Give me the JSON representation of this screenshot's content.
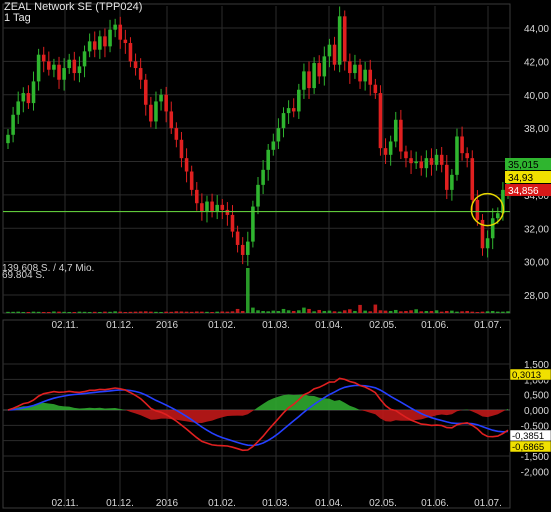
{
  "header": {
    "title": "ZEAL Network SE (TPP024)",
    "interval": "1 Tag"
  },
  "volume_info": {
    "line1": "139.608 S. / 4,7 Mio.",
    "line2": "69.804 S."
  },
  "colors": {
    "up": "#2fb52f",
    "down": "#e02020",
    "support_line": "#5fc83a",
    "highlight_circle": "#e8d800",
    "grid": "#2b2b2b",
    "macd_line": "#e02020",
    "signal_line": "#2540ff",
    "histogram_pos": "#2fa82f",
    "histogram_neg": "#c01818"
  },
  "chart_data": [
    {
      "type": "candlestick",
      "x_tick_labels": [
        "02.11.",
        "01.12.",
        "2016",
        "01.02.",
        "01.03.",
        "01.04.",
        "02.05.",
        "01.06.",
        "01.07."
      ],
      "y_tick_labels": [
        "44,00",
        "42,00",
        "40,00",
        "38,00",
        "36,00",
        "34,00",
        "32,00",
        "30,00",
        "28,00"
      ],
      "ylim": [
        28,
        45
      ],
      "price_badges": [
        {
          "label": "35,015",
          "color": "#2fb52f",
          "text_color": "#000000",
          "value": 35.015
        },
        {
          "label": "34,93",
          "color": "#f0e000",
          "text_color": "#000000",
          "value": 34.93
        },
        {
          "label": "34,856",
          "color": "#d81818",
          "text_color": "#ffffff",
          "value": 34.856
        }
      ],
      "support_level": 33.0,
      "close": [
        37.6,
        38.8,
        39.6,
        40.1,
        39.5,
        40.8,
        42.4,
        42.0,
        41.5,
        41.8,
        40.9,
        41.6,
        42.1,
        41.3,
        41.7,
        42.6,
        43.2,
        42.7,
        43.5,
        42.9,
        43.9,
        44.2,
        43.3,
        43.1,
        42.0,
        41.6,
        40.9,
        39.4,
        38.4,
        39.6,
        40.0,
        39.0,
        38.0,
        37.3,
        36.2,
        35.4,
        34.3,
        33.5,
        33.0,
        33.6,
        33.0,
        33.4,
        33.1,
        32.8,
        31.8,
        31.0,
        30.4,
        31.2,
        33.3,
        34.6,
        35.5,
        36.7,
        37.2,
        38.0,
        38.9,
        39.2,
        39.0,
        40.3,
        41.4,
        40.4,
        41.9,
        41.1,
        42.3,
        43.0,
        41.8,
        44.7,
        42.0,
        41.3,
        41.8,
        40.8,
        41.5,
        40.6,
        40.1,
        36.8,
        36.4,
        37.2,
        38.5,
        36.6,
        36.2,
        35.9,
        36.0,
        35.6,
        36.2,
        35.8,
        36.4,
        35.8,
        34.3,
        35.2,
        37.5,
        36.5,
        36.2,
        33.7,
        32.5,
        30.8,
        31.4,
        32.6,
        32.9,
        34.3,
        35.0
      ],
      "volume": [
        0.0035,
        0.0035,
        0.004,
        0.003,
        0.003,
        0.004,
        0.0035,
        0.003,
        0.003,
        0.0045,
        0.004,
        0.0035,
        0.003,
        0.003,
        0.004,
        0.0035,
        0.003,
        0.0035,
        0.003,
        0.004,
        0.0035,
        0.005,
        0.004,
        0.003,
        0.0035,
        0.004,
        0.0045,
        0.005,
        0.004,
        0.0035,
        0.003,
        0.004,
        0.0035,
        0.005,
        0.0045,
        0.004,
        0.0035,
        0.0045,
        0.004,
        0.0035,
        0.003,
        0.004,
        0.0045,
        0.004,
        0.005,
        0.012,
        0.006,
        0.139,
        0.016,
        0.008,
        0.006,
        0.005,
        0.007,
        0.006,
        0.012,
        0.008,
        0.006,
        0.008,
        0.016,
        0.012,
        0.005,
        0.009,
        0.006,
        0.007,
        0.005,
        0.004,
        0.008,
        0.011,
        0.006,
        0.024,
        0.007,
        0.005,
        0.025,
        0.008,
        0.007,
        0.006,
        0.009,
        0.005,
        0.006,
        0.008,
        0.011,
        0.005,
        0.006,
        0.006,
        0.008,
        0.004,
        0.006,
        0.007,
        0.004,
        0.005,
        0.006,
        0.004,
        0.003,
        0.004,
        0.005,
        0.006,
        0.004,
        0.004,
        0.005,
        0.004
      ]
    },
    {
      "type": "line",
      "series": [
        {
          "name": "macd"
        },
        {
          "name": "signal"
        }
      ],
      "y_tick_labels": [
        "1,500",
        "1,000",
        "0,500",
        "0,000",
        "-0,500",
        "-1,000",
        "-1,500",
        "-2,000"
      ],
      "ylim": [
        -2.1,
        1.5
      ],
      "x_tick_labels": [
        "02.11.",
        "01.12.",
        "2016",
        "01.02.",
        "01.03.",
        "01.04.",
        "02.05.",
        "01.06.",
        "01.07."
      ],
      "value_badges": [
        {
          "label": "0,3013",
          "color": "#f0e000",
          "value": 0.3013
        },
        {
          "label": "-0,3851",
          "color": "#ffffff",
          "value": -0.3851
        },
        {
          "label": "-0,6865",
          "color": "#f0e000",
          "value": -0.6865
        }
      ]
    }
  ]
}
